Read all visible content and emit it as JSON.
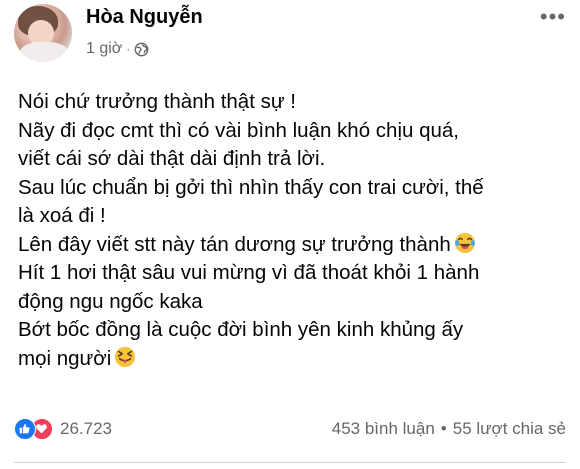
{
  "post": {
    "author_name": "Hòa Nguyễn",
    "timestamp": "1 giờ",
    "separator": "·",
    "privacy_icon": "globe-icon",
    "more_label": "•••",
    "lines": [
      "Nói chứ trưởng thành thật sự !",
      "Nãy đi đọc cmt thì có vài bình luận khó chịu quá,",
      "viết cái sớ dài thật dài định trả lời.",
      "Sau lúc chuẩn bị gởi thì nhìn thấy con trai cười, thế",
      "là xoá đi !",
      "Lên đây viết stt này tán dương sự trưởng thành",
      "Hít 1 hơi thật sâu vui mừng vì đã thoát khỏi 1 hành",
      "động ngu ngốc kaka",
      "Bớt bốc đồng là cuộc đời bình yên kinh khủng ấy",
      "mọi người"
    ],
    "emoji_after_line_6": "tears-of-joy-emoji",
    "emoji_after_line_10": "squinting-tongue-emoji"
  },
  "footer": {
    "reaction_icons": [
      "like-icon",
      "love-icon"
    ],
    "reaction_count": "26.723",
    "comments": "453 bình luận",
    "dot": "•",
    "shares": "55 lượt chia sẻ"
  },
  "colors": {
    "text": "#050505",
    "secondary": "#65676b",
    "like_blue": "#1877f2",
    "love_red": "#f33e58",
    "emoji_yellow": "#f7c33b"
  }
}
